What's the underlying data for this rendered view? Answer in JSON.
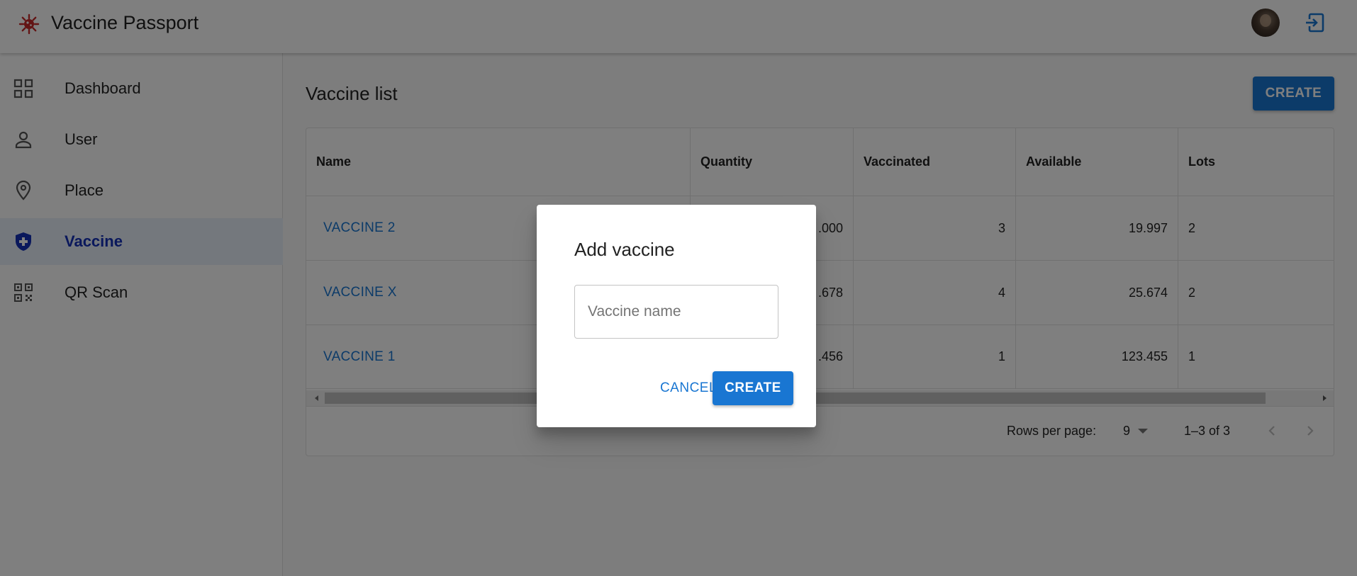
{
  "app": {
    "title": "Vaccine Passport",
    "logo_icon": "virus-icon",
    "logout_icon": "logout-icon",
    "brand_color": "#c62828",
    "accent_color": "#1976d2"
  },
  "sidebar": {
    "items": [
      {
        "label": "Dashboard",
        "icon": "dashboard-icon",
        "active": false
      },
      {
        "label": "User",
        "icon": "person-icon",
        "active": false
      },
      {
        "label": "Place",
        "icon": "location-pin-icon",
        "active": false
      },
      {
        "label": "Vaccine",
        "icon": "shield-icon",
        "active": true
      },
      {
        "label": "QR Scan",
        "icon": "qr-scan-icon",
        "active": false
      }
    ]
  },
  "main": {
    "title": "Vaccine list",
    "create_label": "CREATE",
    "table": {
      "columns": [
        "Name",
        "Quantity",
        "Vaccinated",
        "Available",
        "Lots"
      ],
      "rows": [
        {
          "name": "VACCINE 2",
          "quantity": ".000",
          "vaccinated": "3",
          "available": "19.997",
          "lots": "2"
        },
        {
          "name": "VACCINE X",
          "quantity": ".678",
          "vaccinated": "4",
          "available": "25.674",
          "lots": "2"
        },
        {
          "name": "VACCINE 1",
          "quantity": ".456",
          "vaccinated": "1",
          "available": "123.455",
          "lots": "1"
        }
      ]
    },
    "pagination": {
      "rows_per_page_label": "Rows per page:",
      "rows_per_page_value": "9",
      "range": "1–3 of 3"
    }
  },
  "dialog": {
    "title": "Add vaccine",
    "input_placeholder": "Vaccine name",
    "input_value": "",
    "cancel_label": "CANCEL",
    "create_label": "CREATE"
  }
}
